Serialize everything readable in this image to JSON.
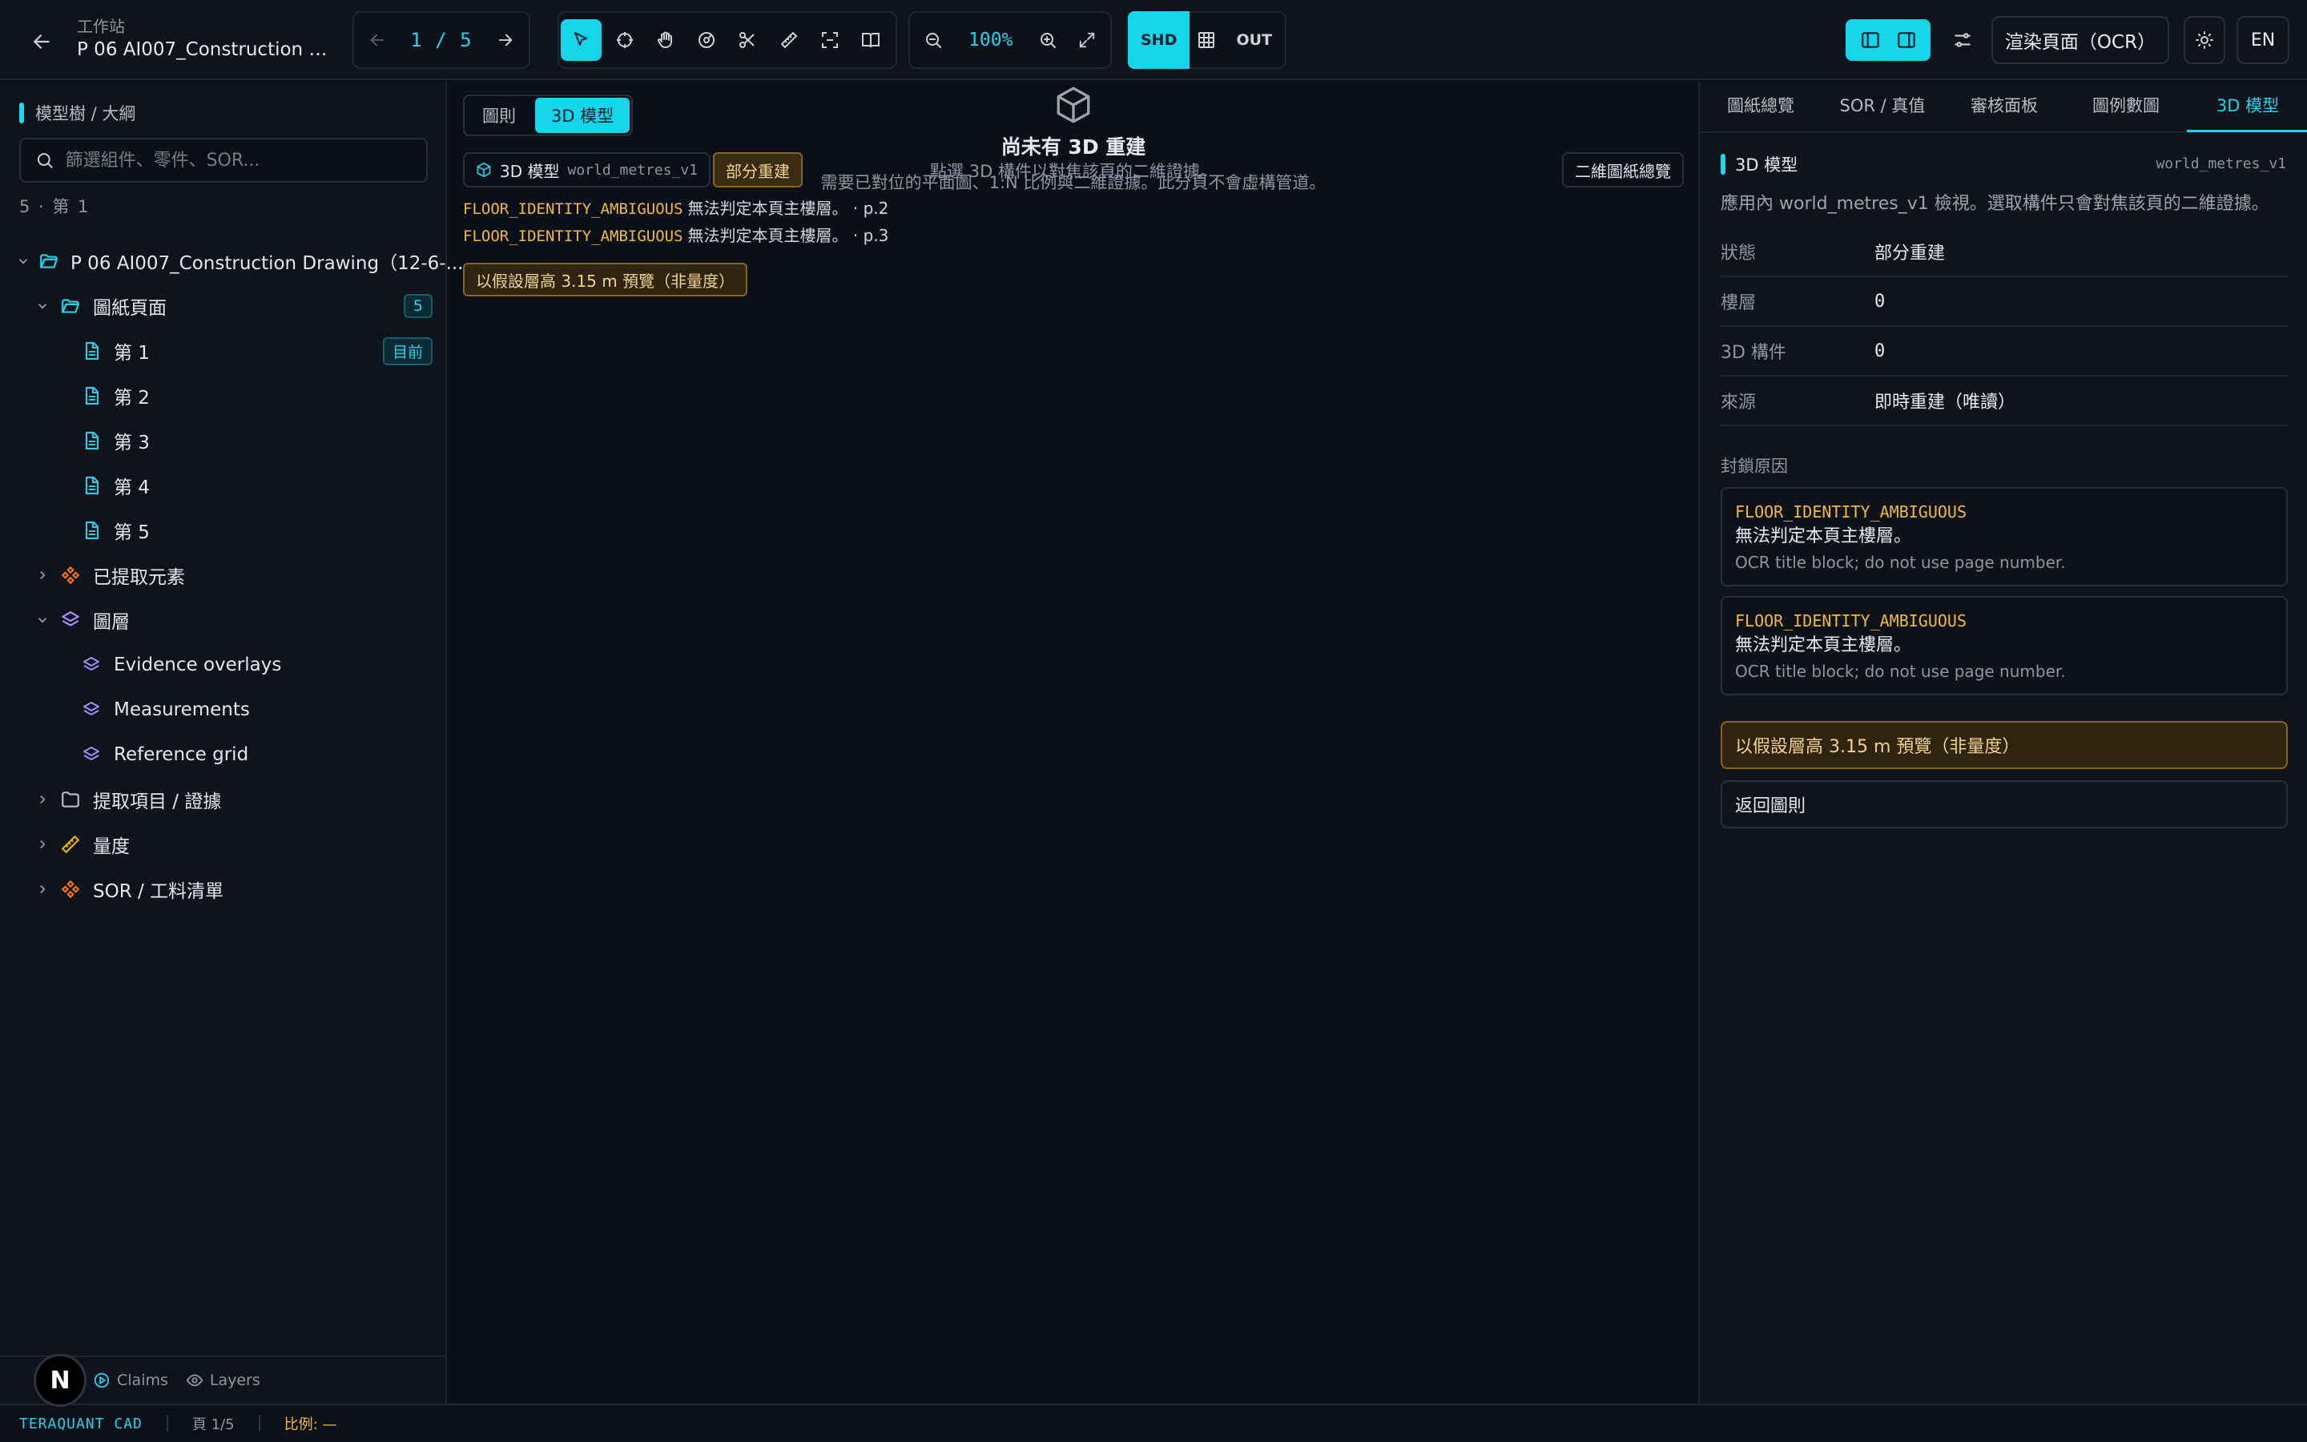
{
  "header": {
    "workspace_label": "工作站",
    "document_title": "P 06 AI007_Construction Dr...",
    "page_indicator": "1 / 5",
    "zoom": "100%",
    "mode_shd": "SHD",
    "mode_out": "OUT",
    "ocr_button": "渲染頁面（OCR）",
    "lang_button": "EN"
  },
  "sidebar": {
    "heading": "模型樹 / 大綱",
    "filter_placeholder": "篩選組件、零件、SOR...",
    "count": "5 · 第 1",
    "root": "P 06 AI007_Construction Drawing（12-6-...",
    "sheets_label": "圖紙頁面",
    "sheets_count": "5",
    "pages": [
      {
        "label": "第 1",
        "badge": "目前"
      },
      {
        "label": "第 2"
      },
      {
        "label": "第 3"
      },
      {
        "label": "第 4"
      },
      {
        "label": "第 5"
      }
    ],
    "extracted": "已提取元素",
    "layers": "圖層",
    "layer_items": [
      "Evidence overlays",
      "Measurements",
      "Reference grid"
    ],
    "evidence": "提取項目 / 證據",
    "quantities": "量度",
    "sor": "SOR / 工料清單",
    "footer_claims": "Claims",
    "footer_layers": "Layers"
  },
  "center": {
    "tab_drawing": "圖則",
    "tab_model": "3D 模型",
    "empty_title": "尚未有 3D 重建",
    "empty_line1": "點選 3D 構件以對焦該頁的二維證據。",
    "empty_line2": "需要已對位的平面圖、1:N 比例與二維證據。此分頁不會虛構管道。",
    "model_chip_label": "3D 模型",
    "model_chip_code": "world_metres_v1",
    "partial_chip": "部分重建",
    "overview_button": "二維圖紙總覽",
    "blockers": [
      {
        "code": "FLOOR_IDENTITY_AMBIGUOUS",
        "text": "無法判定本頁主樓層。 · p.2"
      },
      {
        "code": "FLOOR_IDENTITY_AMBIGUOUS",
        "text": "無法判定本頁主樓層。 · p.3"
      }
    ],
    "assume_chip": "以假設層高 3.15 m 預覽（非量度）"
  },
  "right_panel": {
    "tabs": [
      "圖紙總覽",
      "SOR / 真值",
      "審核面板",
      "圖例數圖",
      "3D 模型"
    ],
    "active_tab": 4,
    "heading": "3D 模型",
    "heading_code": "world_metres_v1",
    "description": "應用內 world_metres_v1 檢視。選取構件只會對焦該頁的二維證據。",
    "fields": [
      {
        "key": "狀態",
        "value": "部分重建"
      },
      {
        "key": "樓層",
        "value": "0"
      },
      {
        "key": "3D 構件",
        "value": "0"
      },
      {
        "key": "來源",
        "value": "即時重建（唯讀）"
      }
    ],
    "blocker_heading": "封鎖原因",
    "reasons": [
      {
        "code": "FLOOR_IDENTITY_AMBIGUOUS",
        "message": "無法判定本頁主樓層。",
        "note": "OCR title block; do not use page number."
      },
      {
        "code": "FLOOR_IDENTITY_AMBIGUOUS",
        "message": "無法判定本頁主樓層。",
        "note": "OCR title block; do not use page number."
      }
    ],
    "assume_button": "以假設層高 3.15 m 預覽（非量度）",
    "return_button": "返回圖則"
  },
  "statusbar": {
    "brand": "TERAQUANT CAD",
    "page": "頁 1/5",
    "scale": "比例: —"
  },
  "avatar_letter": "N",
  "colors": {
    "accent": "#22d3ee",
    "warning": "#f2b93b",
    "background": "#0b1018"
  }
}
